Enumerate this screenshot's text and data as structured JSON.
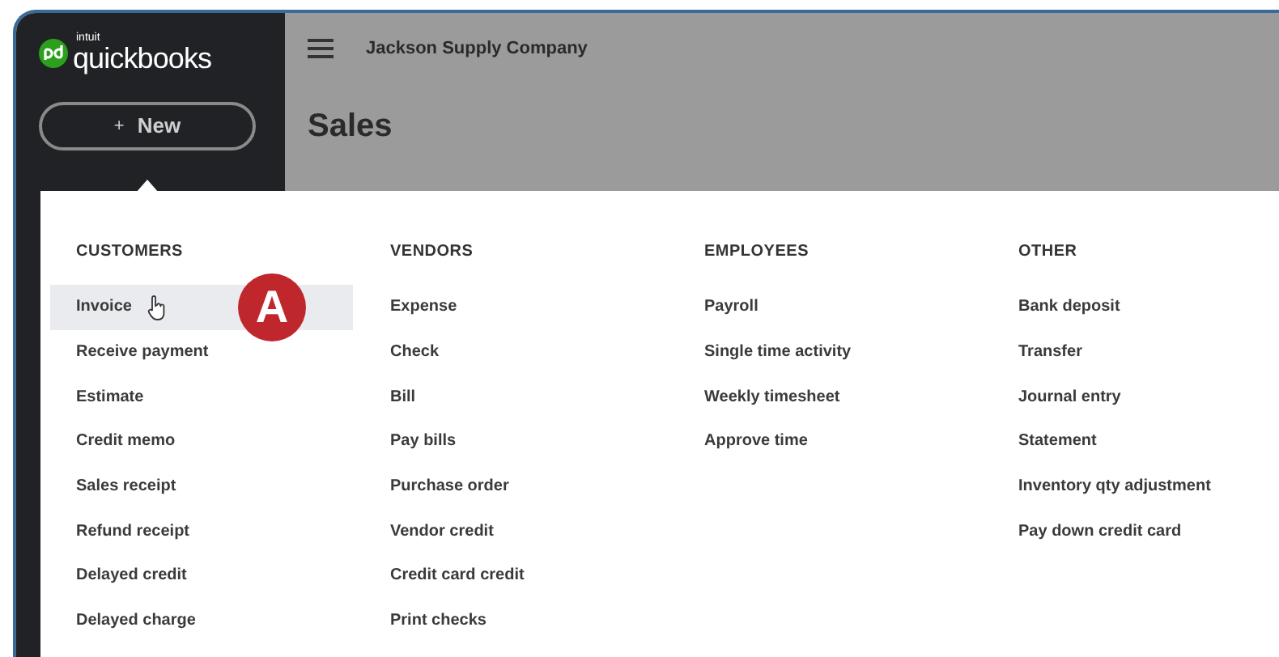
{
  "sidebar": {
    "logo": {
      "brand": "intuit",
      "name": "quickbooks"
    },
    "new_button": {
      "icon": "+",
      "label": "New"
    }
  },
  "header": {
    "company": "Jackson Supply Company",
    "page_title": "Sales"
  },
  "new_menu": {
    "columns": [
      {
        "heading": "CUSTOMERS",
        "items": [
          {
            "label": "Invoice",
            "selected": true
          },
          {
            "label": "Receive payment",
            "selected": false
          },
          {
            "label": "Estimate",
            "selected": false
          },
          {
            "label": "Credit memo",
            "selected": false
          },
          {
            "label": "Sales receipt",
            "selected": false
          },
          {
            "label": "Refund receipt",
            "selected": false
          },
          {
            "label": "Delayed credit",
            "selected": false
          },
          {
            "label": "Delayed charge",
            "selected": false
          }
        ]
      },
      {
        "heading": "VENDORS",
        "items": [
          {
            "label": "Expense",
            "selected": false
          },
          {
            "label": "Check",
            "selected": false
          },
          {
            "label": "Bill",
            "selected": false
          },
          {
            "label": "Pay bills",
            "selected": false
          },
          {
            "label": "Purchase order",
            "selected": false
          },
          {
            "label": "Vendor credit",
            "selected": false
          },
          {
            "label": "Credit card credit",
            "selected": false
          },
          {
            "label": "Print checks",
            "selected": false
          }
        ]
      },
      {
        "heading": "EMPLOYEES",
        "items": [
          {
            "label": "Payroll",
            "selected": false
          },
          {
            "label": "Single time activity",
            "selected": false
          },
          {
            "label": "Weekly timesheet",
            "selected": false
          },
          {
            "label": "Approve time",
            "selected": false
          }
        ]
      },
      {
        "heading": "OTHER",
        "items": [
          {
            "label": "Bank deposit",
            "selected": false
          },
          {
            "label": "Transfer",
            "selected": false
          },
          {
            "label": "Journal entry",
            "selected": false
          },
          {
            "label": "Statement",
            "selected": false
          },
          {
            "label": "Inventory qty adjustment",
            "selected": false
          },
          {
            "label": "Pay down credit card",
            "selected": false
          }
        ]
      }
    ]
  },
  "annotation": {
    "label": "A"
  }
}
